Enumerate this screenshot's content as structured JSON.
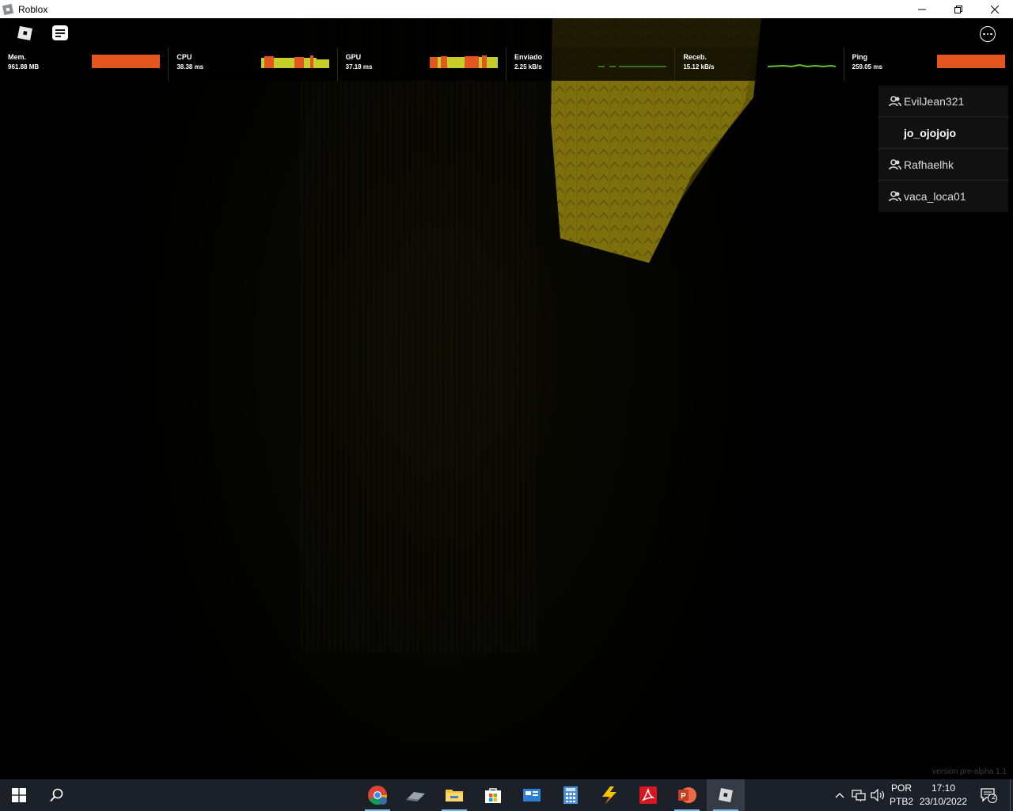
{
  "window": {
    "title": "Roblox"
  },
  "stats": [
    {
      "label": "Mem.",
      "value": "961.88 MB"
    },
    {
      "label": "CPU",
      "value": "38.38 ms"
    },
    {
      "label": "GPU",
      "value": "37.18 ms"
    },
    {
      "label": "Enviado",
      "value": "2.25 kB/s"
    },
    {
      "label": "Receb.",
      "value": "15.12 kB/s"
    },
    {
      "label": "Ping",
      "value": "259.05 ms"
    }
  ],
  "players": [
    {
      "name": "EvilJean321",
      "friend": true
    },
    {
      "name": "jo_ojojojo",
      "friend": false
    },
    {
      "name": "Rafhaelhk",
      "friend": true
    },
    {
      "name": "vaca_loca01",
      "friend": true
    }
  ],
  "version": "version pre-alpha 1.1",
  "taskbar": {
    "language": "POR",
    "layout": "PTB2",
    "time": "17:10",
    "date": "23/10/2022",
    "notifications": "2"
  },
  "colors": {
    "stat_bar": "#e3561f",
    "stat_graph_yellow": "#c6cf2a",
    "net_graph_green": "#6abf2a",
    "taskbar": "#1b2029"
  }
}
